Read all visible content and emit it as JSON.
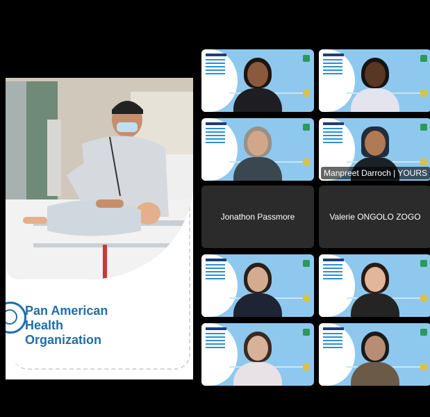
{
  "shared_slide": {
    "org_lines": [
      "Pan American",
      "Health",
      "Organization"
    ]
  },
  "participants": [
    {
      "name": "",
      "type": "video"
    },
    {
      "name": "",
      "type": "video"
    },
    {
      "name": "",
      "type": "video"
    },
    {
      "name": "Manpreet Darroch | YOURS",
      "type": "video"
    },
    {
      "name": "Jonathon Passmore",
      "type": "audio"
    },
    {
      "name": "Valerie ONGOLO ZOGO",
      "type": "audio"
    },
    {
      "name": "",
      "type": "video"
    },
    {
      "name": "",
      "type": "video"
    },
    {
      "name": "",
      "type": "video"
    },
    {
      "name": "",
      "type": "video"
    }
  ],
  "colors": {
    "tile_background": "#8ec8ee",
    "blank_tile": "#2b2b2b",
    "org_blue": "#1f6ea8"
  }
}
